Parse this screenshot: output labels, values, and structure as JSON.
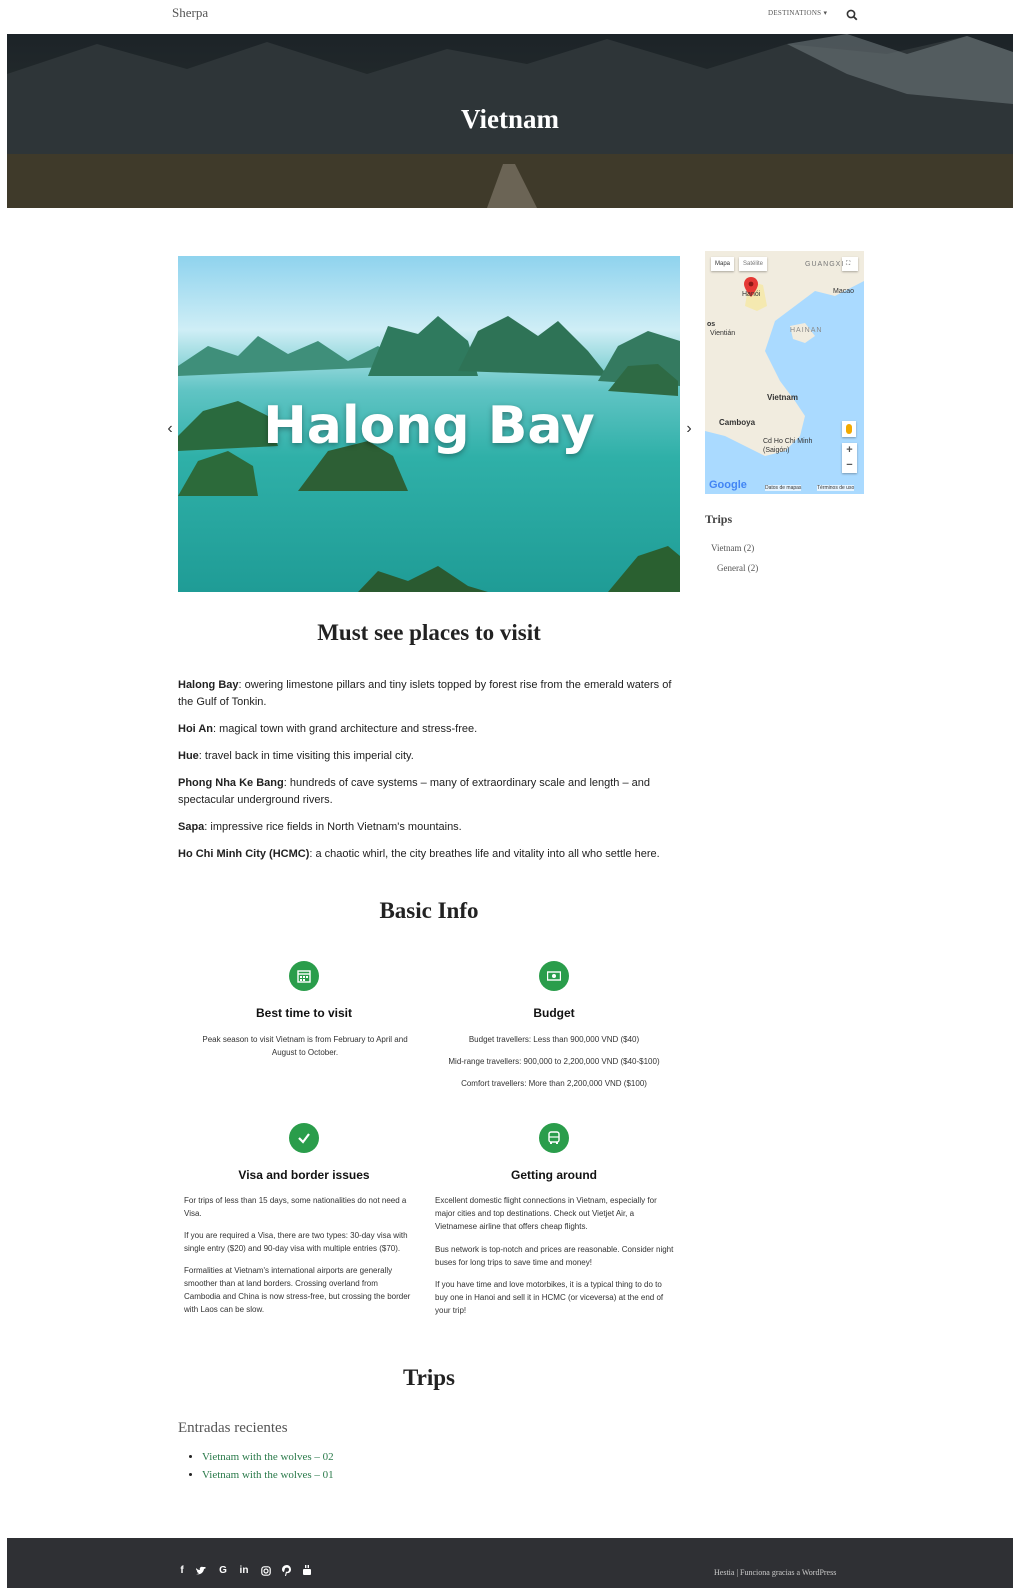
{
  "nav": {
    "brand": "Sherpa",
    "destinations_label": "DESTINATIONS",
    "destinations_caret": "▾"
  },
  "hero": {
    "title": "Vietnam"
  },
  "carousel": {
    "caption": "Halong Bay",
    "prev": "‹",
    "next": "›"
  },
  "map": {
    "map_tab": "Mapa",
    "satellite_tab": "Satélite",
    "labels": {
      "guangxi": "GUANGXI",
      "hanoi": "Hanói",
      "macao": "Macao",
      "laos": "os",
      "vientian": "Vientián",
      "hainan": "HAINAN",
      "vietnam": "Vietnam",
      "camboya": "Camboya",
      "hcmc": "Cd Ho Chi Minh (Saigón)"
    },
    "zoom_in": "+",
    "zoom_out": "−",
    "logo": "Google",
    "map_data": "Datos de mapas",
    "terms": "Términos de uso"
  },
  "sidebar": {
    "title": "Trips",
    "items": [
      {
        "label": "Vietnam (2)"
      },
      {
        "label": "General (2)"
      }
    ]
  },
  "must_see": {
    "title": "Must see places to visit",
    "items": [
      {
        "name": "Halong Bay",
        "text": ": owering limestone pillars and tiny islets topped by forest rise from the emerald waters of the Gulf of Tonkin."
      },
      {
        "name": "Hoi An",
        "text": ": magical town with grand architecture and stress-free."
      },
      {
        "name": "Hue",
        "text": ": travel back in time visiting this imperial city."
      },
      {
        "name": "Phong Nha Ke Bang",
        "text": ": hundreds of cave systems – many of extraordinary scale and length – and spectacular underground rivers."
      },
      {
        "name": "Sapa",
        "text": ": impressive rice fields in North Vietnam's mountains."
      },
      {
        "name": "Ho Chi Minh City (HCMC)",
        "text": ": a chaotic whirl, the city breathes life and vitality into all who settle here."
      }
    ]
  },
  "basic_info": {
    "title": "Basic Info",
    "best_time": {
      "icon": "calendar-icon",
      "title": "Best time to visit",
      "text": "Peak season to visit Vietnam is from February to April and August to October."
    },
    "budget": {
      "icon": "money-icon",
      "title": "Budget",
      "lines": [
        "Budget travellers: Less than 900,000 VND ($40)",
        "Mid-range travellers: 900,000 to 2,200,000 VND ($40-$100)",
        "Comfort travellers: More than 2,200,000 VND ($100)"
      ]
    },
    "visa": {
      "icon": "check-icon",
      "title": "Visa and border issues",
      "paras": [
        "For trips of less than 15 days, some nationalities do not need a Visa.",
        "If you are required a Visa, there are two types: 30-day visa with single entry ($20) and 90-day visa with multiple entries ($70).",
        "Formalities at Vietnam's international airports are generally smoother than at land borders. Crossing overland from Cambodia and China is now stress-free, but crossing the border with Laos can be slow."
      ]
    },
    "getting_around": {
      "icon": "bus-icon",
      "title": "Getting around",
      "paras": [
        "Excellent domestic flight connections in Vietnam, especially for major cities and top destinations. Check out Vietjet Air, a Vietnamese airline that offers cheap flights.",
        "Bus network is top-notch and prices are reasonable. Consider night buses for long trips to save time and money!",
        "If you have time and love motorbikes, it is a typical thing to do to buy one in Hanoi and sell it in HCMC (or viceversa) at the end of your trip!"
      ]
    }
  },
  "trips": {
    "title": "Trips",
    "recent_title": "Entradas recientes",
    "posts": [
      {
        "label": "Vietnam with the wolves – 02"
      },
      {
        "label": "Vietnam with the wolves – 01"
      }
    ]
  },
  "footer": {
    "social": [
      "f",
      "t",
      "G",
      "in",
      "ig",
      "p",
      "yt"
    ],
    "credit": "Hestia | Funciona gracias a WordPress"
  },
  "colors": {
    "accent_green": "#2a9d4b",
    "link_green": "#2a7a4a",
    "footer_bg": "#2f3034"
  }
}
